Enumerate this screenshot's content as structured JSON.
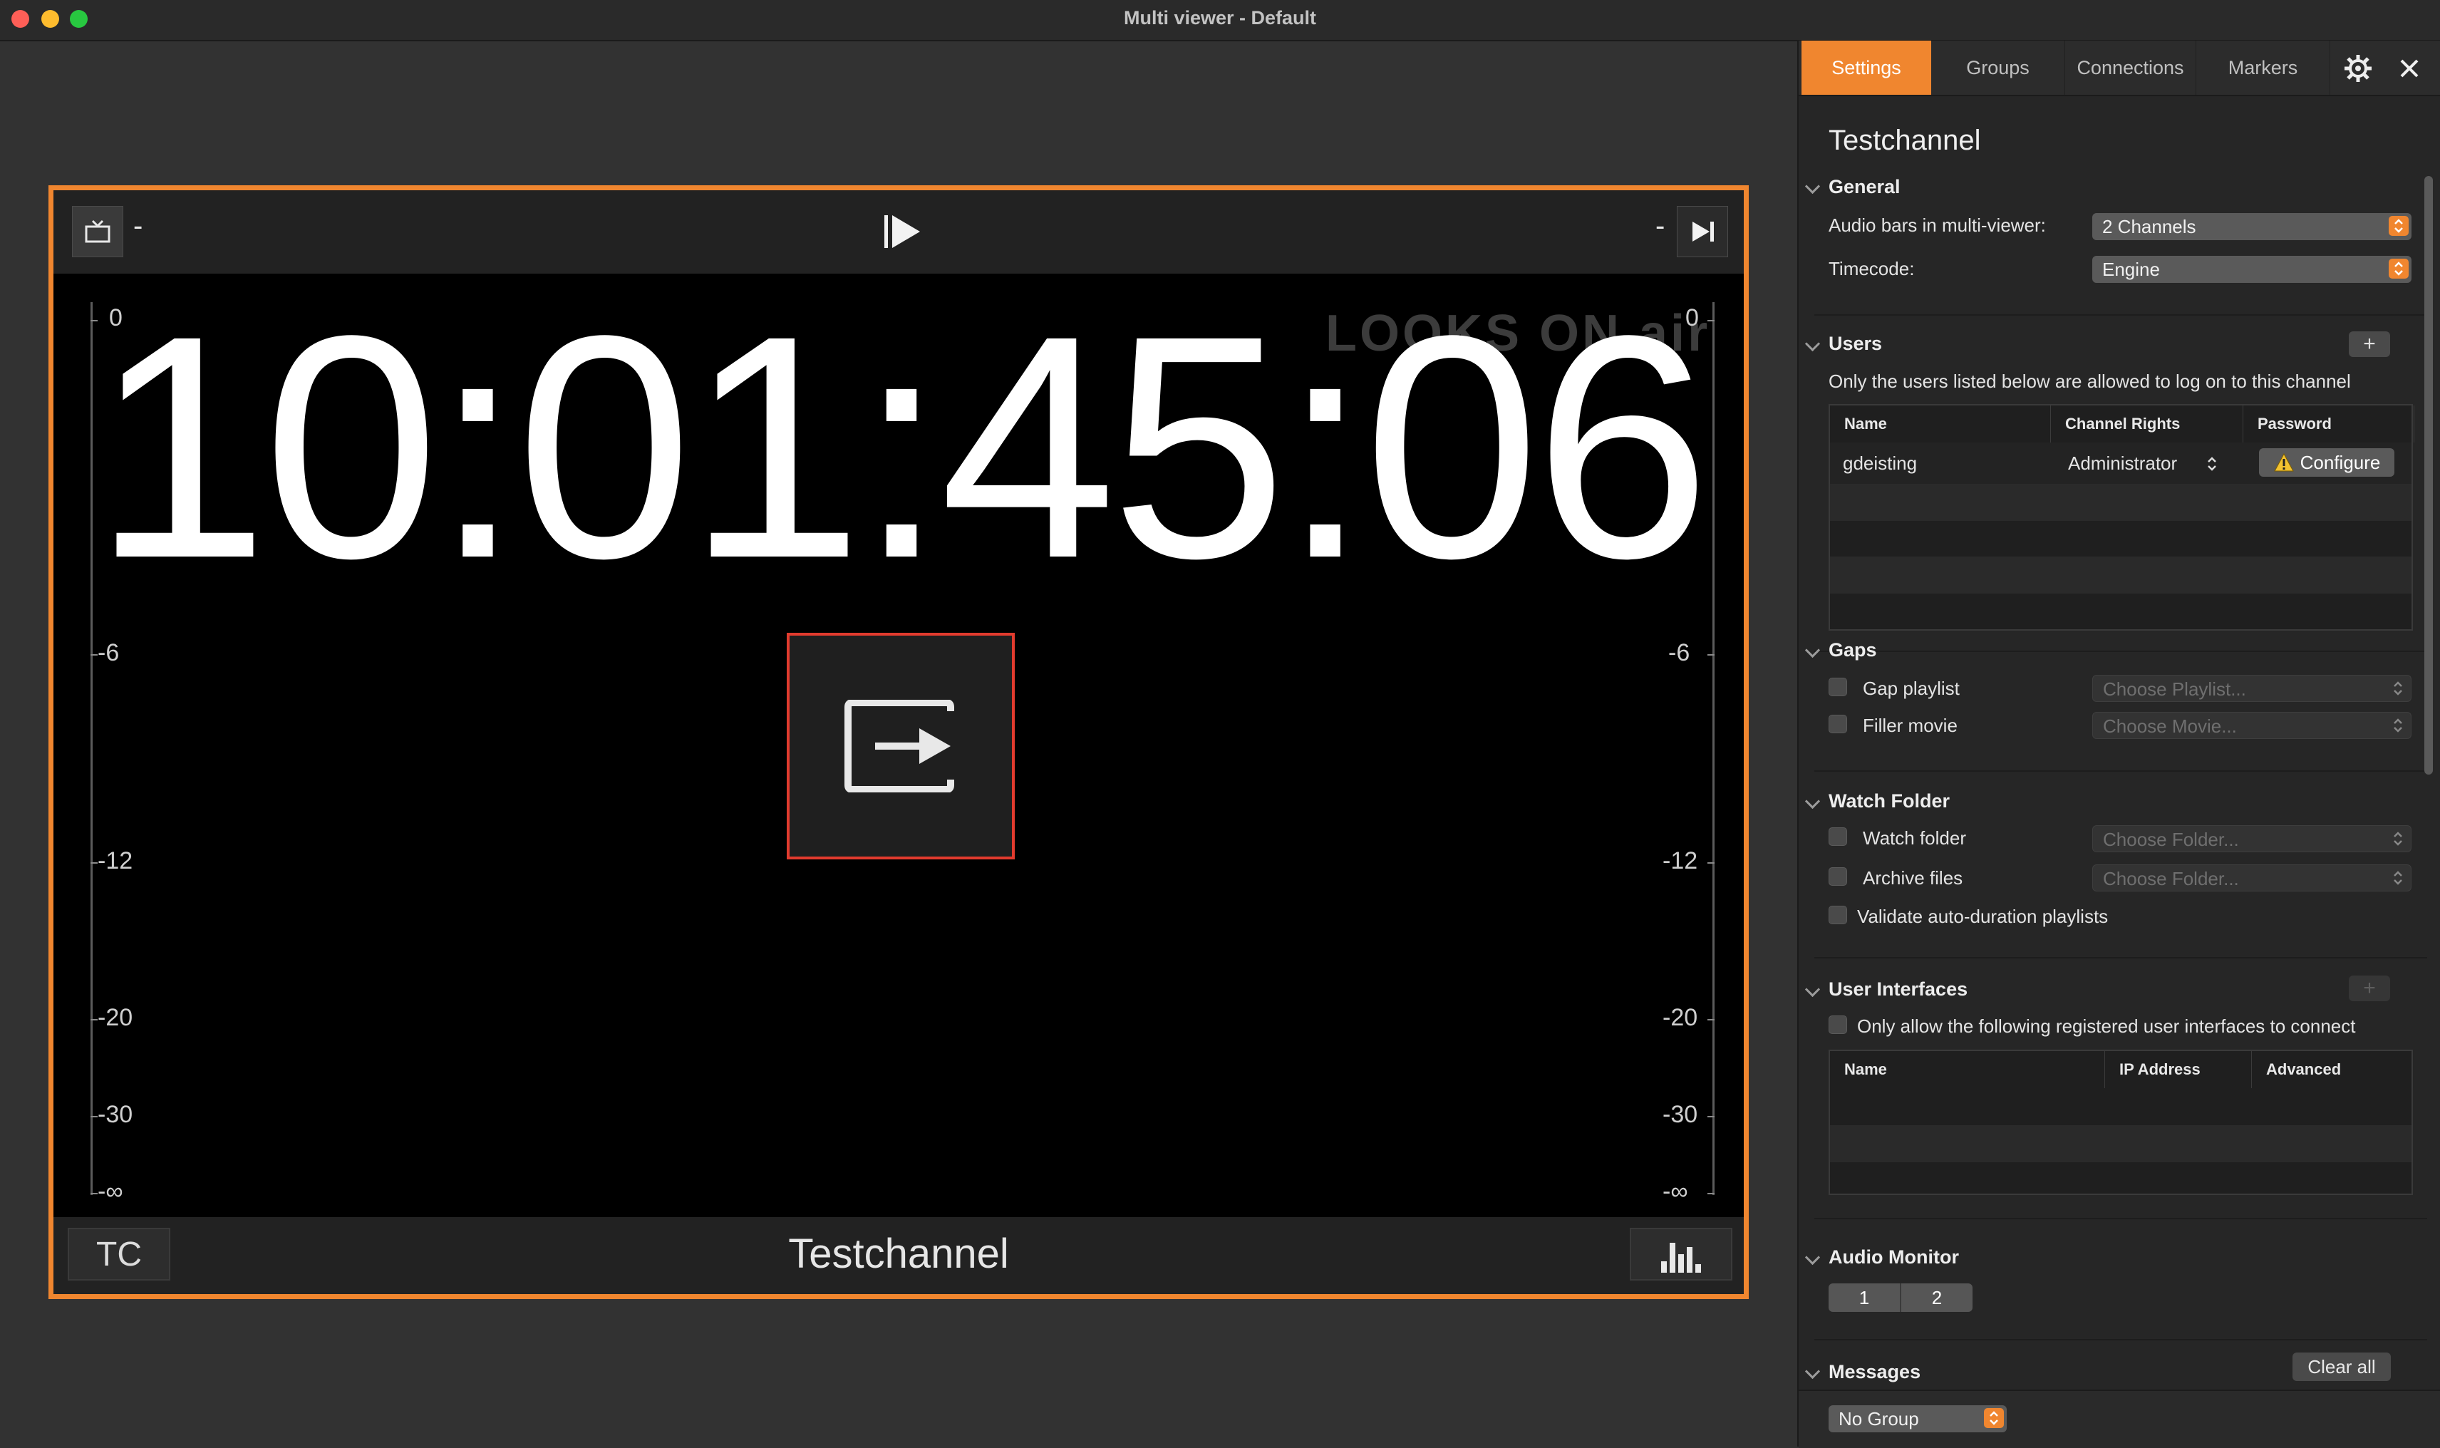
{
  "window": {
    "title": "Multi viewer - Default"
  },
  "viewer": {
    "left_dash": "-",
    "right_dash": "-",
    "timecode": "10:01:45:06",
    "watermark": "LOOKS ON air",
    "scale_left": [
      "0",
      "-6",
      "-12",
      "-20",
      "-30",
      "-∞"
    ],
    "scale_right": [
      "0",
      "-6",
      "-12",
      "-20",
      "-30",
      "-∞"
    ],
    "tc_label": "TC",
    "channel_name": "Testchannel"
  },
  "panel": {
    "tabs": [
      "Settings",
      "Groups",
      "Connections",
      "Markers"
    ],
    "active_tab": "Settings",
    "title": "Testchannel",
    "general": {
      "heading": "General",
      "audio_bars_label": "Audio bars in multi-viewer:",
      "audio_bars_value": "2 Channels",
      "timecode_label": "Timecode:",
      "timecode_value": "Engine"
    },
    "users": {
      "heading": "Users",
      "add": "+",
      "description": "Only the users listed below are allowed to log on to this channel",
      "columns": [
        "Name",
        "Channel Rights",
        "Password"
      ],
      "rows": [
        {
          "name": "gdeisting",
          "rights": "Administrator",
          "password_action": "Configure"
        }
      ]
    },
    "gaps": {
      "heading": "Gaps",
      "gap_playlist_label": "Gap playlist",
      "gap_playlist_placeholder": "Choose Playlist...",
      "filler_movie_label": "Filler movie",
      "filler_movie_placeholder": "Choose Movie..."
    },
    "watch_folder": {
      "heading": "Watch Folder",
      "watch_folder_label": "Watch folder",
      "watch_folder_placeholder": "Choose Folder...",
      "archive_label": "Archive files",
      "archive_placeholder": "Choose Folder...",
      "validate_label": "Validate auto-duration playlists"
    },
    "user_interfaces": {
      "heading": "User Interfaces",
      "add": "+",
      "only_allow_label": "Only allow the following registered user interfaces to connect",
      "columns": [
        "Name",
        "IP Address",
        "Advanced"
      ]
    },
    "audio_monitor": {
      "heading": "Audio Monitor",
      "channels": [
        "1",
        "2"
      ]
    },
    "messages": {
      "heading": "Messages",
      "clear_all": "Clear all"
    },
    "footer": {
      "group_select": "No Group"
    }
  },
  "colors": {
    "accent": "#f0862f",
    "highlight_border": "#e23b2e",
    "background": "#323232"
  }
}
